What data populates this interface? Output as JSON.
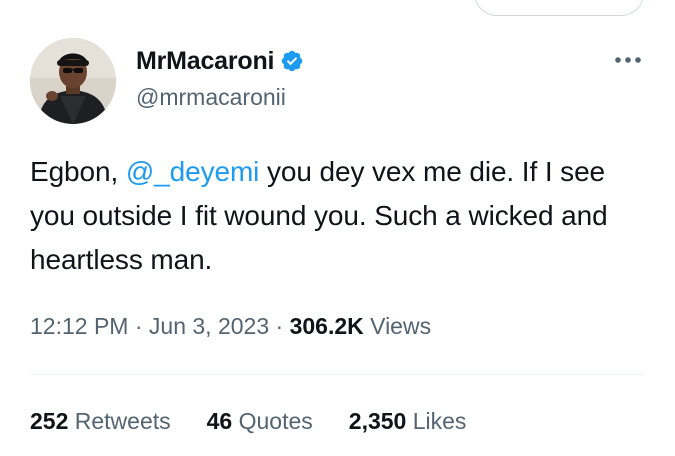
{
  "author": {
    "display_name": "MrMacaroni",
    "handle": "@mrmacaronii",
    "verified": true
  },
  "tweet": {
    "text_before": "Egbon, ",
    "mention": "@_deyemi",
    "text_after": " you dey vex me die. If I see you outside I fit wound you. Such a wicked and heartless man."
  },
  "meta": {
    "time": "12:12 PM",
    "separator1": " · ",
    "date": "Jun 3, 2023",
    "separator2": " · ",
    "views_count": "306.2K",
    "views_label": " Views"
  },
  "stats": {
    "retweets_count": "252",
    "retweets_label": " Retweets",
    "quotes_count": "46",
    "quotes_label": " Quotes",
    "likes_count": "2,350",
    "likes_label": " Likes"
  },
  "colors": {
    "accent": "#1d9bf0",
    "text_primary": "#0f1419",
    "text_secondary": "#536471"
  },
  "icons": {
    "verified": "verified-badge-icon",
    "more": "more-options-icon"
  }
}
